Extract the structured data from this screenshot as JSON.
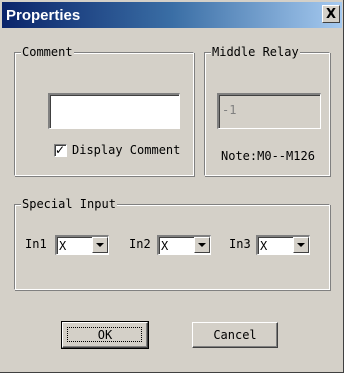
{
  "window": {
    "title": "Properties",
    "close_glyph": "X"
  },
  "comment": {
    "group_label": "Comment",
    "value": "",
    "display_checkbox": {
      "label": "Display Comment",
      "checked": true,
      "check_glyph": "✓"
    }
  },
  "middle_relay": {
    "group_label": "Middle Relay",
    "value": "-1",
    "note": "Note:M0--M126"
  },
  "special_input": {
    "group_label": "Special Input",
    "inputs": [
      {
        "label": "In1",
        "value": "X"
      },
      {
        "label": "In2",
        "value": "X"
      },
      {
        "label": "In3",
        "value": "X"
      }
    ]
  },
  "buttons": {
    "ok_label": "OK",
    "cancel_label": "Cancel"
  },
  "icons": {
    "close": "close-icon",
    "checkmark": "checkmark-icon",
    "dropdown": "chevron-down-icon"
  }
}
